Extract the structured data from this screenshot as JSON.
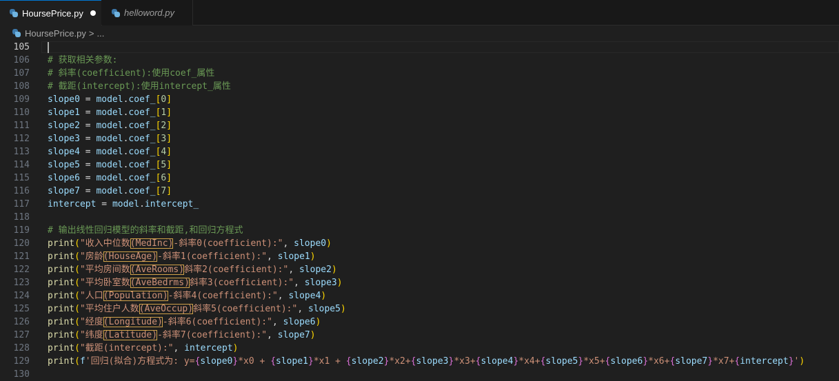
{
  "tabs": [
    {
      "label": "HoursePrice.py",
      "icon": "python-file-icon",
      "modified": true
    },
    {
      "label": "helloword.py",
      "icon": "python-file-icon",
      "modified": false
    }
  ],
  "breadcrumb": {
    "file": "HoursePrice.py",
    "separator": ">",
    "more": "..."
  },
  "lines": [
    {
      "n": "105",
      "t": []
    },
    {
      "n": "106",
      "t": [
        [
          "c",
          "# 获取相关参数:"
        ]
      ]
    },
    {
      "n": "107",
      "t": [
        [
          "c",
          "# 斜率(coefficient):使用coef_属性"
        ]
      ]
    },
    {
      "n": "108",
      "t": [
        [
          "c",
          "# 截距(intercept):使用intercept_属性"
        ]
      ]
    },
    {
      "n": "109",
      "t": [
        [
          "v",
          "slope0"
        ],
        [
          "p",
          " = "
        ],
        [
          "v",
          "model"
        ],
        [
          "p",
          "."
        ],
        [
          "v",
          "coef_"
        ],
        [
          "b",
          "["
        ],
        [
          "n",
          "0"
        ],
        [
          "b",
          "]"
        ]
      ]
    },
    {
      "n": "110",
      "t": [
        [
          "v",
          "slope1"
        ],
        [
          "p",
          " = "
        ],
        [
          "v",
          "model"
        ],
        [
          "p",
          "."
        ],
        [
          "v",
          "coef_"
        ],
        [
          "b",
          "["
        ],
        [
          "n",
          "1"
        ],
        [
          "b",
          "]"
        ]
      ]
    },
    {
      "n": "111",
      "t": [
        [
          "v",
          "slope2"
        ],
        [
          "p",
          " = "
        ],
        [
          "v",
          "model"
        ],
        [
          "p",
          "."
        ],
        [
          "v",
          "coef_"
        ],
        [
          "b",
          "["
        ],
        [
          "n",
          "2"
        ],
        [
          "b",
          "]"
        ]
      ]
    },
    {
      "n": "112",
      "t": [
        [
          "v",
          "slope3"
        ],
        [
          "p",
          " = "
        ],
        [
          "v",
          "model"
        ],
        [
          "p",
          "."
        ],
        [
          "v",
          "coef_"
        ],
        [
          "b",
          "["
        ],
        [
          "n",
          "3"
        ],
        [
          "b",
          "]"
        ]
      ]
    },
    {
      "n": "113",
      "t": [
        [
          "v",
          "slope4"
        ],
        [
          "p",
          " = "
        ],
        [
          "v",
          "model"
        ],
        [
          "p",
          "."
        ],
        [
          "v",
          "coef_"
        ],
        [
          "b",
          "["
        ],
        [
          "n",
          "4"
        ],
        [
          "b",
          "]"
        ]
      ]
    },
    {
      "n": "114",
      "t": [
        [
          "v",
          "slope5"
        ],
        [
          "p",
          " = "
        ],
        [
          "v",
          "model"
        ],
        [
          "p",
          "."
        ],
        [
          "v",
          "coef_"
        ],
        [
          "b",
          "["
        ],
        [
          "n",
          "5"
        ],
        [
          "b",
          "]"
        ]
      ]
    },
    {
      "n": "115",
      "t": [
        [
          "v",
          "slope6"
        ],
        [
          "p",
          " = "
        ],
        [
          "v",
          "model"
        ],
        [
          "p",
          "."
        ],
        [
          "v",
          "coef_"
        ],
        [
          "b",
          "["
        ],
        [
          "n",
          "6"
        ],
        [
          "b",
          "]"
        ]
      ]
    },
    {
      "n": "116",
      "t": [
        [
          "v",
          "slope7"
        ],
        [
          "p",
          " = "
        ],
        [
          "v",
          "model"
        ],
        [
          "p",
          "."
        ],
        [
          "v",
          "coef_"
        ],
        [
          "b",
          "["
        ],
        [
          "n",
          "7"
        ],
        [
          "b",
          "]"
        ]
      ]
    },
    {
      "n": "117",
      "t": [
        [
          "v",
          "intercept"
        ],
        [
          "p",
          " = "
        ],
        [
          "v",
          "model"
        ],
        [
          "p",
          "."
        ],
        [
          "v",
          "intercept_"
        ]
      ]
    },
    {
      "n": "118",
      "t": []
    },
    {
      "n": "119",
      "t": [
        [
          "c",
          "# 输出线性回归模型的斜率和截距,和回归方程式"
        ]
      ]
    },
    {
      "n": "120",
      "t": [
        [
          "f",
          "print"
        ],
        [
          "b",
          "("
        ],
        [
          "s",
          "\"收入中位数"
        ],
        [
          "sh",
          "(MedInc)"
        ],
        [
          "s",
          "-斜率0(coefficient):\""
        ],
        [
          "p",
          ", "
        ],
        [
          "v",
          "slope0"
        ],
        [
          "b",
          ")"
        ]
      ]
    },
    {
      "n": "121",
      "t": [
        [
          "f",
          "print"
        ],
        [
          "b",
          "("
        ],
        [
          "s",
          "\"房龄"
        ],
        [
          "sh",
          "(HouseAge)"
        ],
        [
          "s",
          "-斜率1(coefficient):\""
        ],
        [
          "p",
          ", "
        ],
        [
          "v",
          "slope1"
        ],
        [
          "b",
          ")"
        ]
      ]
    },
    {
      "n": "122",
      "t": [
        [
          "f",
          "print"
        ],
        [
          "b",
          "("
        ],
        [
          "s",
          "\"平均房间数"
        ],
        [
          "sh",
          "(AveRooms)"
        ],
        [
          "s",
          "斜率2(coefficient):\""
        ],
        [
          "p",
          ", "
        ],
        [
          "v",
          "slope2"
        ],
        [
          "b",
          ")"
        ]
      ]
    },
    {
      "n": "123",
      "t": [
        [
          "f",
          "print"
        ],
        [
          "b",
          "("
        ],
        [
          "s",
          "\"平均卧室数"
        ],
        [
          "sh",
          "(AveBedrms)"
        ],
        [
          "s",
          "斜率3(coefficient):\""
        ],
        [
          "p",
          ", "
        ],
        [
          "v",
          "slope3"
        ],
        [
          "b",
          ")"
        ]
      ]
    },
    {
      "n": "124",
      "t": [
        [
          "f",
          "print"
        ],
        [
          "b",
          "("
        ],
        [
          "s",
          "\"人口"
        ],
        [
          "sh",
          "(Population)"
        ],
        [
          "s",
          "-斜率4(coefficient):\""
        ],
        [
          "p",
          ", "
        ],
        [
          "v",
          "slope4"
        ],
        [
          "b",
          ")"
        ]
      ]
    },
    {
      "n": "125",
      "t": [
        [
          "f",
          "print"
        ],
        [
          "b",
          "("
        ],
        [
          "s",
          "\"平均住户人数"
        ],
        [
          "sh",
          "(AveOccup)"
        ],
        [
          "s",
          "斜率5(coefficient):\""
        ],
        [
          "p",
          ", "
        ],
        [
          "v",
          "slope5"
        ],
        [
          "b",
          ")"
        ]
      ]
    },
    {
      "n": "126",
      "t": [
        [
          "f",
          "print"
        ],
        [
          "b",
          "("
        ],
        [
          "s",
          "\"经度"
        ],
        [
          "sh",
          "(Longitude)"
        ],
        [
          "s",
          "-斜率6(coefficient):\""
        ],
        [
          "p",
          ", "
        ],
        [
          "v",
          "slope6"
        ],
        [
          "b",
          ")"
        ]
      ]
    },
    {
      "n": "127",
      "t": [
        [
          "f",
          "print"
        ],
        [
          "b",
          "("
        ],
        [
          "s",
          "\"纬度"
        ],
        [
          "sh",
          "(Latitude)"
        ],
        [
          "s",
          "-斜率7(coefficient):\""
        ],
        [
          "p",
          ", "
        ],
        [
          "v",
          "slope7"
        ],
        [
          "b",
          ")"
        ]
      ]
    },
    {
      "n": "128",
      "t": [
        [
          "f",
          "print"
        ],
        [
          "b",
          "("
        ],
        [
          "s",
          "\"截距(intercept):\""
        ],
        [
          "p",
          ", "
        ],
        [
          "v",
          "intercept"
        ],
        [
          "b",
          ")"
        ]
      ]
    },
    {
      "n": "129",
      "t": [
        [
          "f",
          "print"
        ],
        [
          "b",
          "("
        ],
        [
          "v",
          "f"
        ],
        [
          "s",
          "'回归(拟合)方程式为: y="
        ],
        [
          "b2",
          "{"
        ],
        [
          "v",
          "slope0"
        ],
        [
          "b2",
          "}"
        ],
        [
          "s",
          "*x0 + "
        ],
        [
          "b2",
          "{"
        ],
        [
          "v",
          "slope1"
        ],
        [
          "b2",
          "}"
        ],
        [
          "s",
          "*x1 + "
        ],
        [
          "b2",
          "{"
        ],
        [
          "v",
          "slope2"
        ],
        [
          "b2",
          "}"
        ],
        [
          "s",
          "*x2+"
        ],
        [
          "b2",
          "{"
        ],
        [
          "v",
          "slope3"
        ],
        [
          "b2",
          "}"
        ],
        [
          "s",
          "*x3+"
        ],
        [
          "b2",
          "{"
        ],
        [
          "v",
          "slope4"
        ],
        [
          "b2",
          "}"
        ],
        [
          "s",
          "*x4+"
        ],
        [
          "b2",
          "{"
        ],
        [
          "v",
          "slope5"
        ],
        [
          "b2",
          "}"
        ],
        [
          "s",
          "*x5+"
        ],
        [
          "b2",
          "{"
        ],
        [
          "v",
          "slope6"
        ],
        [
          "b2",
          "}"
        ],
        [
          "s",
          "*x6+"
        ],
        [
          "b2",
          "{"
        ],
        [
          "v",
          "slope7"
        ],
        [
          "b2",
          "}"
        ],
        [
          "s",
          "*x7+"
        ],
        [
          "b2",
          "{"
        ],
        [
          "v",
          "intercept"
        ],
        [
          "b2",
          "}"
        ],
        [
          "s",
          "'"
        ],
        [
          "b",
          ")"
        ]
      ]
    },
    {
      "n": "130",
      "t": []
    }
  ],
  "current_line": "105"
}
